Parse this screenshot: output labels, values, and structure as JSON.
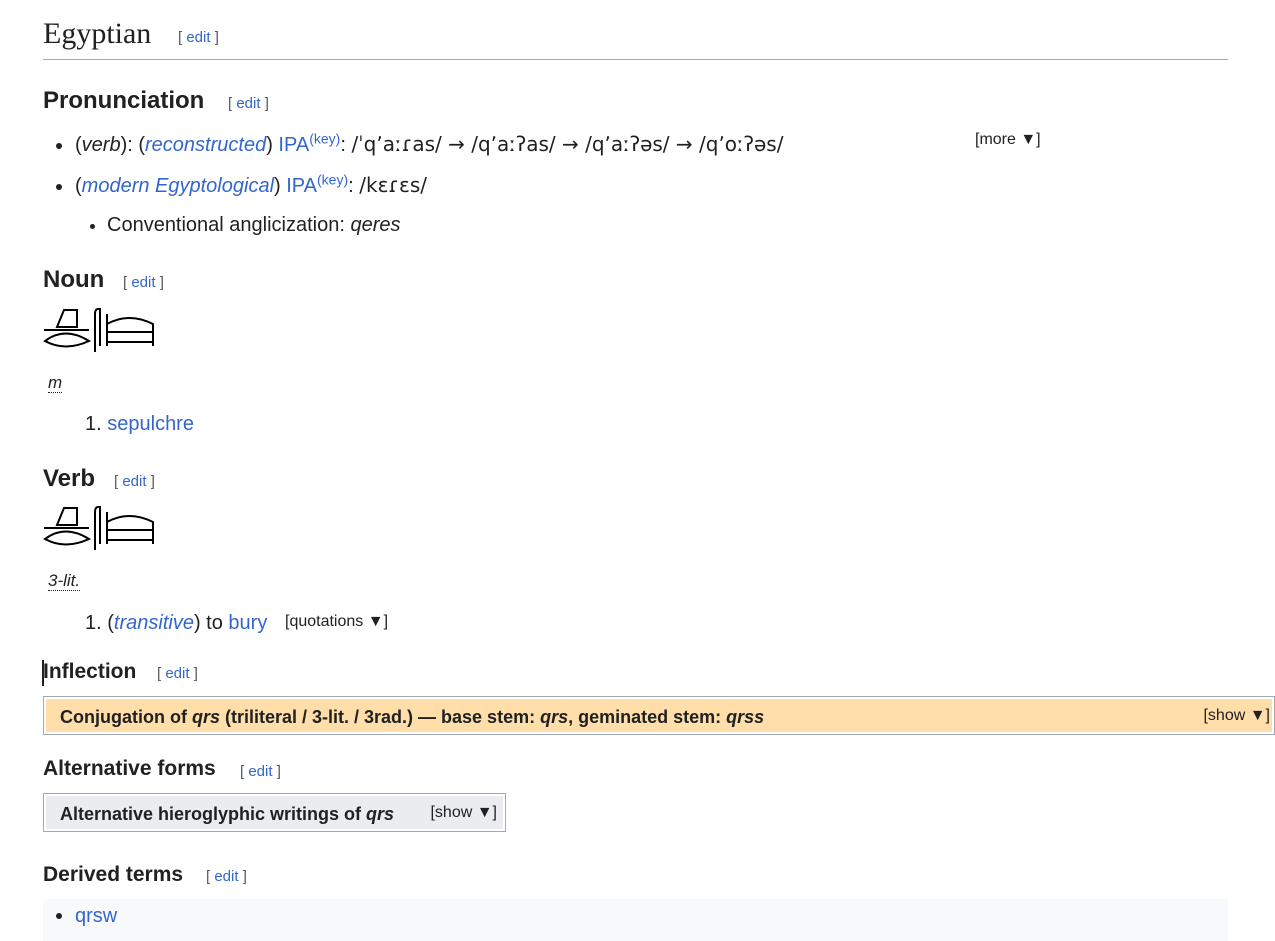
{
  "lang": {
    "title": "Egyptian",
    "edit_label": "edit"
  },
  "pronunciation": {
    "heading": "Pronunciation",
    "edit_label": "edit",
    "item1": {
      "open": "(",
      "pos": "verb",
      "mid": "): (",
      "qualifier": "reconstructed",
      "close": ")",
      "ipa_label": "IPA",
      "key_label": "(key)",
      "colon": ": ",
      "transcription": "/ˈqʼaːɾas/ → /qʼaːʔas/ → /qʼaːʔəs/ → /qʼoːʔəs/",
      "more_toggle": "[more ▼]"
    },
    "item2": {
      "open": "(",
      "qualifier": "modern Egyptological",
      "close": ")",
      "ipa_label": "IPA",
      "key_label": "(key)",
      "colon": ": ",
      "transcription": "/kɛɾɛs/"
    },
    "anglicization": {
      "label": "Conventional anglicization: ",
      "value": "qeres"
    }
  },
  "noun": {
    "heading": "Noun",
    "edit_label": "edit",
    "gender": "m",
    "senses": [
      {
        "num": "1.",
        "text": "sepulchre"
      }
    ]
  },
  "verb": {
    "heading": "Verb",
    "edit_label": "edit",
    "class_label": "3-lit.",
    "senses": [
      {
        "num": "1.",
        "open": "(",
        "qualifier": "transitive",
        "close": ")",
        "to": " to ",
        "word": "bury",
        "quotations_toggle": "[quotations ▼]"
      }
    ]
  },
  "inflection": {
    "heading": "Inflection",
    "edit_label": "edit",
    "table_title_parts": [
      "Conjugation of ",
      "qrs",
      " (triliteral / 3-lit. / 3rad.) — base stem: ",
      "qrs",
      ", geminated stem: ",
      "qrss"
    ],
    "show_toggle": "[show ▼]",
    "header_color": "#ffdeaa"
  },
  "alternative_forms": {
    "heading": "Alternative forms",
    "edit_label": "edit",
    "box_title_parts": [
      "Alternative hieroglyphic writings of ",
      "qrs"
    ],
    "show_toggle": "[show ▼]"
  },
  "derived_terms": {
    "heading": "Derived terms",
    "edit_label": "edit",
    "items": [
      "qrsw"
    ]
  },
  "colors": {
    "link": "#3366cc",
    "text": "#202122",
    "rule": "#a2a9b1",
    "derived_bg": "#f8f9fa"
  }
}
